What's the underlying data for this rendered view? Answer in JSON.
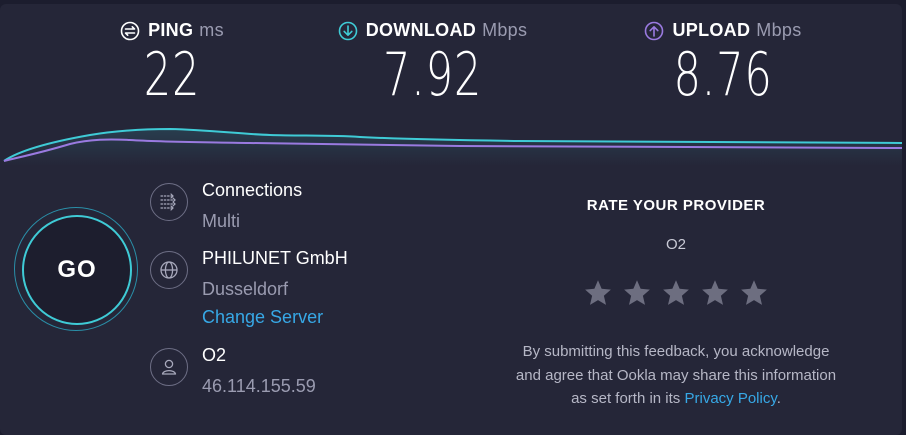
{
  "metrics": {
    "ping": {
      "label": "PING",
      "unit": "ms",
      "value": "22",
      "icon": "ping-icon",
      "color": "#ffffff"
    },
    "download": {
      "label": "DOWNLOAD",
      "unit": "Mbps",
      "value": "7.92",
      "icon": "download-icon",
      "color": "#3fcbd6"
    },
    "upload": {
      "label": "UPLOAD",
      "unit": "Mbps",
      "value": "8.76",
      "icon": "upload-icon",
      "color": "#9a7ae0"
    }
  },
  "go_button": {
    "label": "GO"
  },
  "connections": {
    "title": "Connections",
    "value": "Multi",
    "icon": "connections-icon"
  },
  "server": {
    "name": "PHILUNET GmbH",
    "location": "Dusseldorf",
    "change_label": "Change Server",
    "icon": "globe-icon"
  },
  "client": {
    "isp": "O2",
    "ip": "46.114.155.59",
    "icon": "user-icon"
  },
  "rating": {
    "title": "RATE YOUR PROVIDER",
    "provider": "O2",
    "stars_total": 5,
    "stars_selected": 0,
    "disclaimer_line1": "By submitting this feedback, you acknowledge",
    "disclaimer_line2": "and agree that Ookla may share this information",
    "disclaimer_line3_prefix": "as set forth in its ",
    "privacy_link": "Privacy Policy",
    "disclaimer_suffix": "."
  },
  "colors": {
    "background": "#252638",
    "download_line": "#3fcbd6",
    "upload_line": "#9a7ae0",
    "link": "#37a8e6",
    "star": "#6d6e80"
  }
}
